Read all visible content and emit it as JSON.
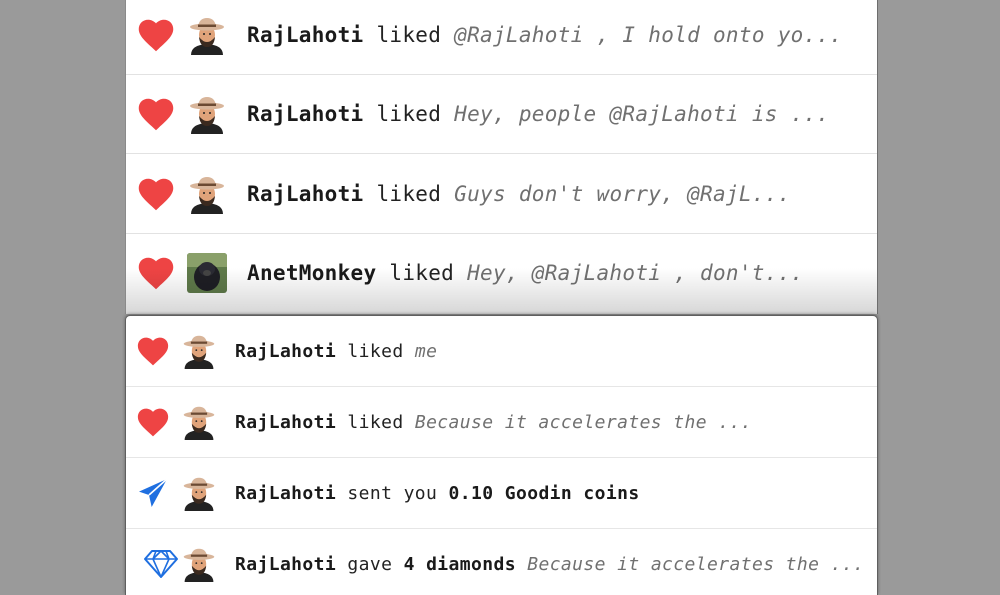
{
  "colors": {
    "heart": "#ee4444",
    "send": "#1f6fe0",
    "diamond": "#1f6fe0",
    "backdrop": "#9a9a9a"
  },
  "top_list": [
    {
      "icon": "heart-icon",
      "user": "RajLahoti",
      "verb": "liked",
      "snippet": "@RajLahoti , I hold onto yo...",
      "avatar": "cowboy-hat-avatar"
    },
    {
      "icon": "heart-icon",
      "user": "RajLahoti",
      "verb": "liked",
      "snippet": "Hey, people @RajLahoti is ...",
      "avatar": "cowboy-hat-avatar"
    },
    {
      "icon": "heart-icon",
      "user": "RajLahoti",
      "verb": "liked",
      "snippet": "Guys don't worry, @RajL...",
      "avatar": "cowboy-hat-avatar"
    },
    {
      "icon": "heart-icon",
      "user": "AnetMonkey",
      "verb": "liked",
      "snippet": "Hey, @RajLahoti , don't...",
      "avatar": "monkey-photo-avatar"
    }
  ],
  "bottom_list": [
    {
      "icon": "heart-icon",
      "user": "RajLahoti",
      "verb": "liked",
      "snippet": "me",
      "avatar": "cowboy-hat-avatar"
    },
    {
      "icon": "heart-icon",
      "user": "RajLahoti",
      "verb": "liked",
      "snippet": "Because it accelerates the ...",
      "avatar": "cowboy-hat-avatar"
    },
    {
      "icon": "send-icon",
      "user": "RajLahoti",
      "verb": "sent you",
      "amount": "0.10 Goodin coins",
      "avatar": "cowboy-hat-avatar"
    },
    {
      "icon": "diamond-icon",
      "user": "RajLahoti",
      "verb": "gave",
      "amount": "4 diamonds",
      "snippet": "Because it accelerates the ...",
      "avatar": "cowboy-hat-avatar"
    }
  ]
}
